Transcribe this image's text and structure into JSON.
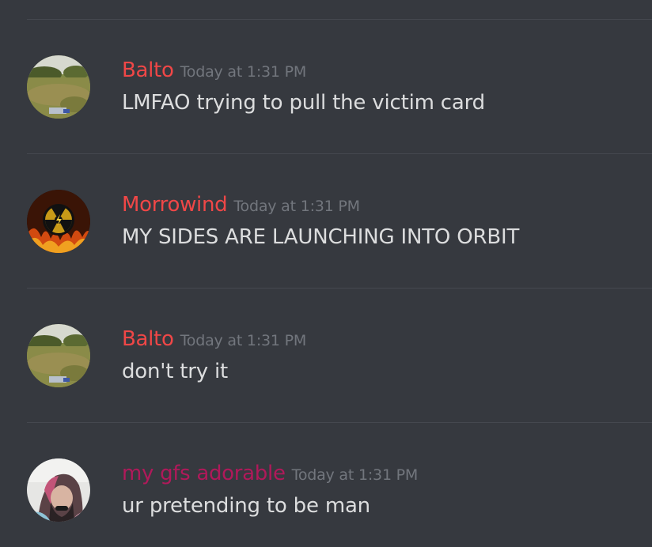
{
  "colors": {
    "background": "#36393f",
    "divider": "#45484f",
    "timestamp": "#72767d",
    "message_text": "#dcddde"
  },
  "messages": [
    {
      "avatar_icon": "field-photo-avatar",
      "username": "Balto",
      "username_color": "#f04747",
      "timestamp": "Today at 1:31 PM",
      "content": "LMFAO trying to pull the victim card"
    },
    {
      "avatar_icon": "radiation-fire-avatar",
      "username": "Morrowind",
      "username_color": "#f04747",
      "timestamp": "Today at 1:31 PM",
      "content": "MY SIDES ARE LAUNCHING INTO ORBIT"
    },
    {
      "avatar_icon": "field-photo-avatar",
      "username": "Balto",
      "username_color": "#f04747",
      "timestamp": "Today at 1:31 PM",
      "content": "don't try it"
    },
    {
      "avatar_icon": "person-photo-avatar",
      "username": "my gfs adorable",
      "username_color": "#b0195a",
      "timestamp": "Today at 1:31 PM",
      "content": "ur pretending to be man"
    }
  ]
}
